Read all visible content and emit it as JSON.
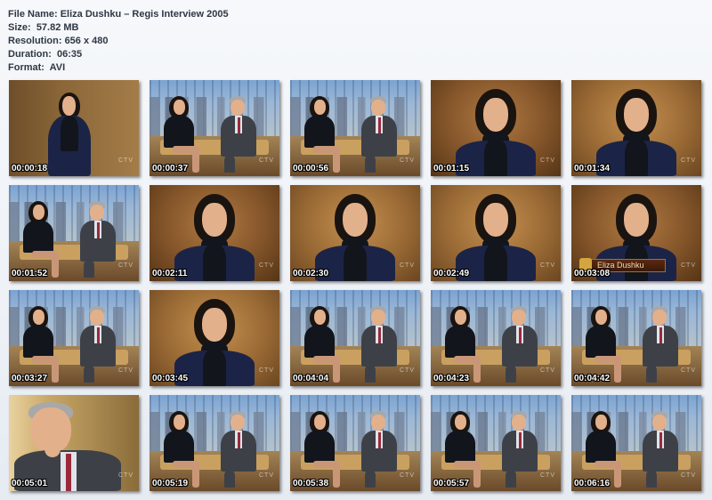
{
  "file_info": {
    "name_label": "File Name:",
    "name_value": "Eliza Dushku – Regis Interview 2005",
    "size_label": "Size:",
    "size_value": "57.82 MB",
    "resolution_label": "Resolution:",
    "resolution_value": "656 x 480",
    "duration_label": "Duration:",
    "duration_value": "06:35",
    "format_label": "Format:",
    "format_value": "AVI"
  },
  "thumbnails": [
    {
      "timestamp": "00:00:18",
      "scene": "intro"
    },
    {
      "timestamp": "00:00:37",
      "scene": "wide"
    },
    {
      "timestamp": "00:00:56",
      "scene": "wide"
    },
    {
      "timestamp": "00:01:15",
      "scene": "close"
    },
    {
      "timestamp": "00:01:34",
      "scene": "close"
    },
    {
      "timestamp": "00:01:52",
      "scene": "wide"
    },
    {
      "timestamp": "00:02:11",
      "scene": "close"
    },
    {
      "timestamp": "00:02:30",
      "scene": "close"
    },
    {
      "timestamp": "00:02:49",
      "scene": "close"
    },
    {
      "timestamp": "00:03:08",
      "scene": "close-caption"
    },
    {
      "timestamp": "00:03:27",
      "scene": "wide"
    },
    {
      "timestamp": "00:03:45",
      "scene": "close"
    },
    {
      "timestamp": "00:04:04",
      "scene": "wide"
    },
    {
      "timestamp": "00:04:23",
      "scene": "wide"
    },
    {
      "timestamp": "00:04:42",
      "scene": "wide"
    },
    {
      "timestamp": "00:05:01",
      "scene": "host"
    },
    {
      "timestamp": "00:05:19",
      "scene": "wide"
    },
    {
      "timestamp": "00:05:38",
      "scene": "wide"
    },
    {
      "timestamp": "00:05:57",
      "scene": "wide"
    },
    {
      "timestamp": "00:06:16",
      "scene": "wide"
    }
  ],
  "channel_logo": "CTV",
  "caption_name": "Eliza Dushku"
}
